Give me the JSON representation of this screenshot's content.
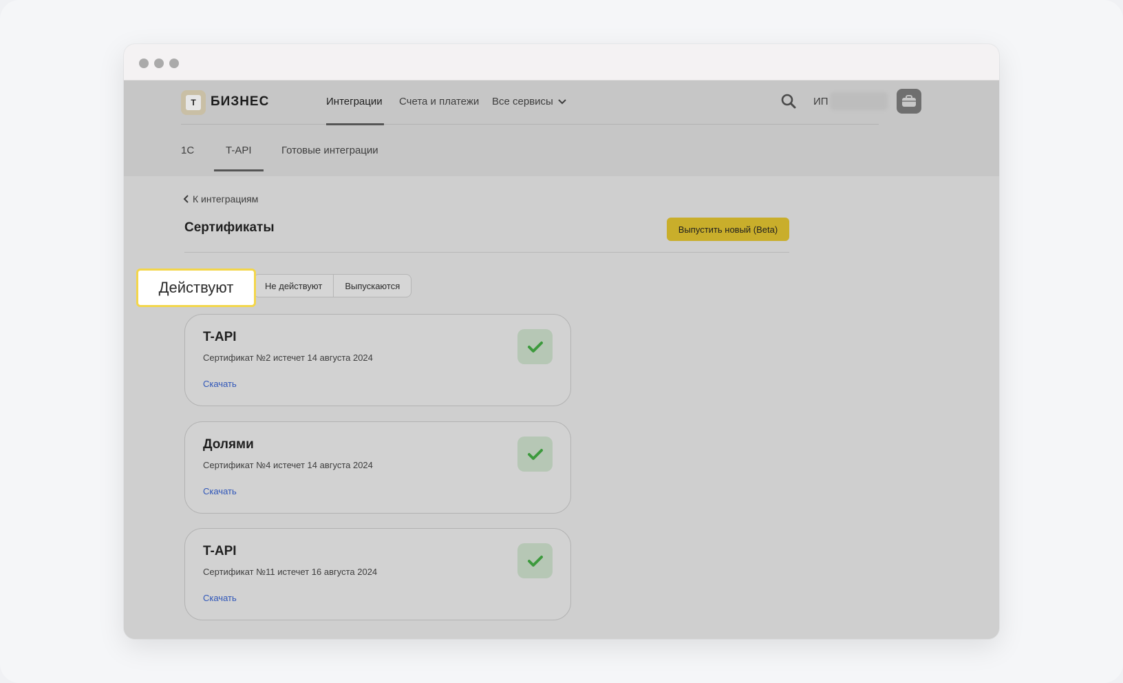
{
  "header": {
    "logo_letter": "Т",
    "logo_text": "БИЗНЕС",
    "nav": [
      "Интеграции",
      "Счета и платежи",
      "Все сервисы"
    ],
    "user_prefix": "ИП"
  },
  "subnav": [
    "1С",
    "T-API",
    "Готовые интеграции"
  ],
  "page": {
    "back_label": "К интеграциям",
    "title": "Сертификаты",
    "issue_button": "Выпустить новый (Beta)"
  },
  "tabs": {
    "active": "Действуют",
    "inactive": "Не действуют",
    "pending": "Выпускаются"
  },
  "certificates": [
    {
      "title": "T-API",
      "subtitle": "Сертификат №2 истечет 14 августа 2024",
      "link": "Скачать"
    },
    {
      "title": "Долями",
      "subtitle": "Сертификат №4 истечет 14 августа 2024",
      "link": "Скачать"
    },
    {
      "title": "T-API",
      "subtitle": "Сертификат №11 истечет 16 августа 2024",
      "link": "Скачать"
    }
  ],
  "colors": {
    "accent_yellow": "#c9ae2b",
    "highlight_border": "#f3d64a",
    "link_blue": "#2e55b8",
    "check_green": "#3d9a3d"
  },
  "icons": [
    "chevron-down-icon",
    "search-icon",
    "briefcase-icon",
    "chevron-left-icon",
    "check-icon"
  ]
}
